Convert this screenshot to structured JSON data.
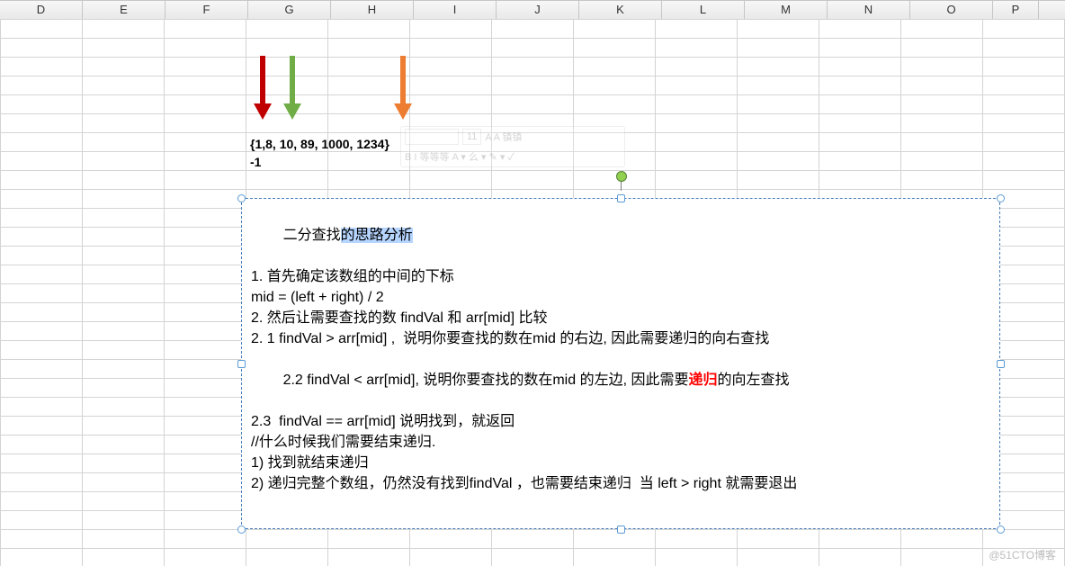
{
  "columns": [
    "D",
    "E",
    "F",
    "G",
    "H",
    "I",
    "J",
    "K",
    "L",
    "M",
    "N",
    "O",
    "P"
  ],
  "data_set": "{1,8, 10, 89, 1000, 1234}",
  "data_neg": "-1",
  "textbox": {
    "title_pre": "二分查找",
    "title_sel": "的思路分析",
    "l1": "1. 首先确定该数组的中间的下标",
    "l2": "mid = (left + right) / 2",
    "l3": "2. 然后让需要查找的数 findVal 和 arr[mid] 比较",
    "l4": "2. 1 findVal > arr[mid] ,  说明你要查找的数在mid 的右边, 因此需要递归的向右查找",
    "l5a": "2.2 findVal < arr[mid], 说明你要查找的数在mid 的左边, 因此需要",
    "l5b": "递归",
    "l5c": "的向左查找",
    "l6": "2.3  findVal == arr[mid] 说明找到，就返回",
    "blank": "",
    "l7": "//什么时候我们需要结束递归.",
    "l8": "1) 找到就结束递归",
    "l9": "2) 递归完整个数组，仍然没有找到findVal ，也需要结束递归  当 left > right 就需要退出"
  },
  "mini_toolbar": {
    "font_size": "11",
    "buttons": "A A 镇镇",
    "row2": "B I 等等等 A ▾ 么 ▾ ✎ ▾ ✓"
  },
  "watermark": "@51CTO博客"
}
